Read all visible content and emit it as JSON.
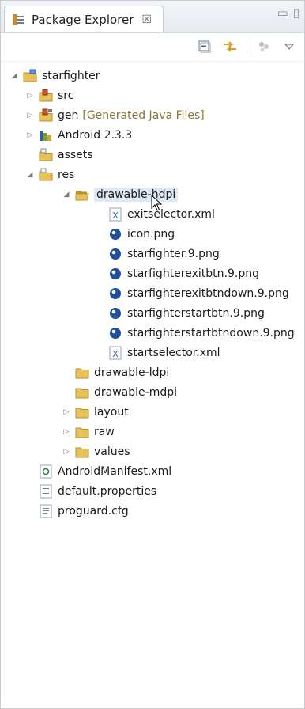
{
  "view": {
    "title": "Package Explorer",
    "close_glyph": "☒",
    "minimize_glyph": "▭",
    "maximize_glyph": "▯"
  },
  "toolbar": {
    "items": [
      {
        "name": "collapse-all-icon"
      },
      {
        "name": "link-with-editor-icon"
      },
      {
        "name": "filter-icon"
      },
      {
        "name": "view-menu-chevron-icon"
      }
    ]
  },
  "tree": [
    {
      "label": "starfighter",
      "icon": "project-icon",
      "indent": 0,
      "twisty": "expanded"
    },
    {
      "label": "src",
      "icon": "source-folder-icon",
      "indent": 1,
      "twisty": "collapsed"
    },
    {
      "label": "gen",
      "suffix": "[Generated Java Files]",
      "icon": "generated-folder-icon",
      "indent": 1,
      "twisty": "collapsed"
    },
    {
      "label": "Android 2.3.3",
      "icon": "android-library-icon",
      "indent": 1,
      "twisty": "collapsed"
    },
    {
      "label": "assets",
      "icon": "package-folder-icon",
      "indent": 1,
      "twisty": "none"
    },
    {
      "label": "res",
      "icon": "package-folder-icon",
      "indent": 1,
      "twisty": "expanded"
    },
    {
      "label": "drawable-hdpi",
      "icon": "folder-open-icon",
      "indent": 2,
      "twisty": "expanded",
      "selected": true
    },
    {
      "label": "exitselector.xml",
      "icon": "xml-file-icon",
      "indent": 3,
      "twisty": "none"
    },
    {
      "label": "icon.png",
      "icon": "image-file-icon",
      "indent": 3,
      "twisty": "none"
    },
    {
      "label": "starfighter.9.png",
      "icon": "image-file-icon",
      "indent": 3,
      "twisty": "none"
    },
    {
      "label": "starfighterexitbtn.9.png",
      "icon": "image-file-icon",
      "indent": 3,
      "twisty": "none"
    },
    {
      "label": "starfighterexitbtndown.9.png",
      "icon": "image-file-icon",
      "indent": 3,
      "twisty": "none"
    },
    {
      "label": "starfighterstartbtn.9.png",
      "icon": "image-file-icon",
      "indent": 3,
      "twisty": "none"
    },
    {
      "label": "starfighterstartbtndown.9.png",
      "icon": "image-file-icon",
      "indent": 3,
      "twisty": "none"
    },
    {
      "label": "startselector.xml",
      "icon": "xml-file-icon",
      "indent": 3,
      "twisty": "none"
    },
    {
      "label": "drawable-ldpi",
      "icon": "folder-icon",
      "indent": 2,
      "twisty": "none"
    },
    {
      "label": "drawable-mdpi",
      "icon": "folder-icon",
      "indent": 2,
      "twisty": "none"
    },
    {
      "label": "layout",
      "icon": "folder-icon",
      "indent": 2,
      "twisty": "collapsed"
    },
    {
      "label": "raw",
      "icon": "folder-icon",
      "indent": 2,
      "twisty": "collapsed"
    },
    {
      "label": "values",
      "icon": "folder-icon",
      "indent": 2,
      "twisty": "collapsed"
    },
    {
      "label": "AndroidManifest.xml",
      "icon": "manifest-file-icon",
      "indent": 1,
      "twisty": "none"
    },
    {
      "label": "default.properties",
      "icon": "properties-file-icon",
      "indent": 1,
      "twisty": "none"
    },
    {
      "label": "proguard.cfg",
      "icon": "text-file-icon",
      "indent": 1,
      "twisty": "none"
    }
  ],
  "colors": {
    "folder": "#e7c25a",
    "folder_dark": "#b8912b",
    "image_blue": "#1f4f9e",
    "xml_blue": "#3b63b0",
    "android_green": "#7aa51f",
    "selection": "#dfe9f5"
  }
}
